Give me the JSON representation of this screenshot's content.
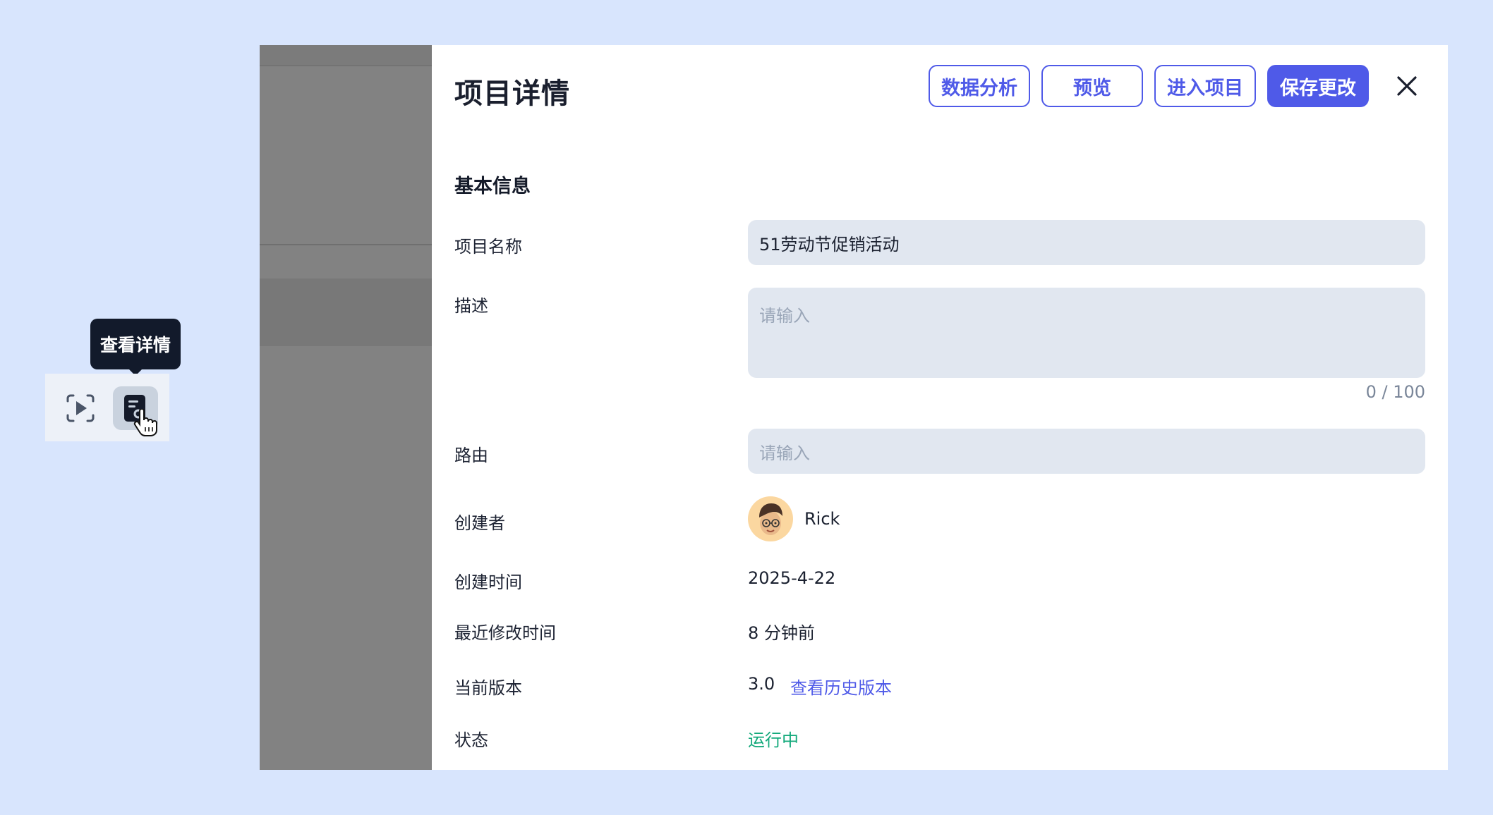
{
  "toolbar": {
    "tooltip": "查看详情"
  },
  "drawer": {
    "title": "项目详情",
    "buttons": {
      "analysis": "数据分析",
      "preview": "预览",
      "enter": "进入项目",
      "save": "保存更改"
    },
    "section_title": "基本信息",
    "fields": {
      "name_label": "项目名称",
      "name_value": "51劳动节促销活动",
      "desc_label": "描述",
      "desc_placeholder": "请输入",
      "desc_counter": "0 / 100",
      "route_label": "路由",
      "route_placeholder": "请输入",
      "creator_label": "创建者",
      "creator_name": "Rick",
      "created_label": "创建时间",
      "created_value": "2025-4-22",
      "modified_label": "最近修改时间",
      "modified_value": "8 分钟前",
      "version_label": "当前版本",
      "version_value": "3.0",
      "version_link": "查看历史版本",
      "status_label": "状态",
      "status_value": "运行中"
    }
  },
  "colors": {
    "background": "#d8e5fd",
    "accent": "#4f5ae8",
    "status_running": "#13a97b",
    "input_bg": "#e1e7f0"
  },
  "icons": [
    "play-preview-icon",
    "doc-search-icon",
    "pointer-cursor-icon",
    "close-icon"
  ]
}
